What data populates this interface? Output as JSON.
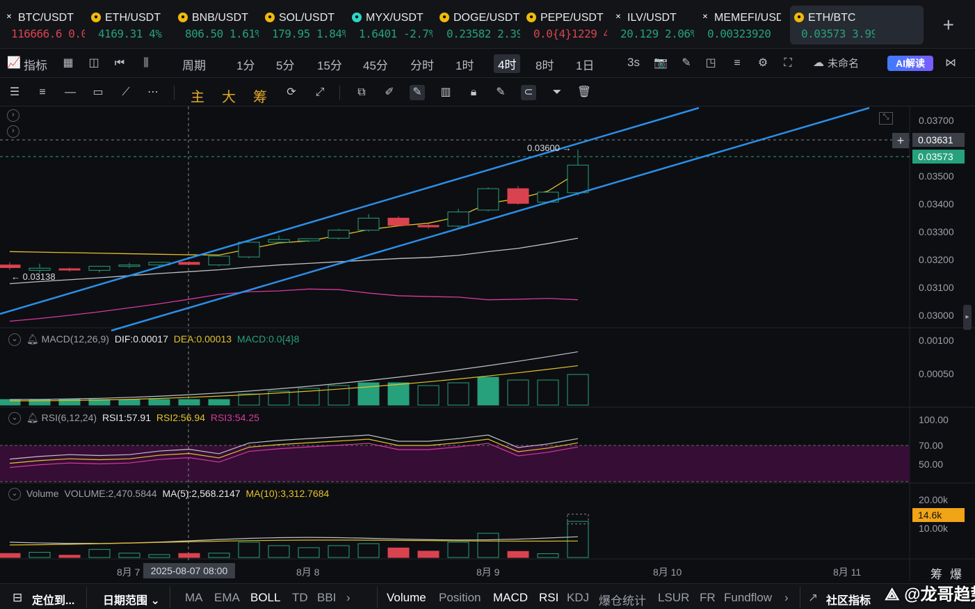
{
  "tickers": [
    {
      "name": "BTC/USDT",
      "price": "116666.6",
      "change": "0.0",
      "dir": "dn",
      "icon": "binance-icon",
      "color": "#ffffff"
    },
    {
      "name": "ETH/USDT",
      "price": "4169.31",
      "change": "4%",
      "dir": "up",
      "icon": "coin-icon",
      "color": "#f0b90b"
    },
    {
      "name": "BNB/USDT",
      "price": "806.50",
      "change": "1.61%",
      "dir": "up",
      "icon": "coin-icon",
      "color": "#f0b90b"
    },
    {
      "name": "SOL/USDT",
      "price": "179.95",
      "change": "1.84%",
      "dir": "up",
      "icon": "coin-icon",
      "color": "#f0b90b"
    },
    {
      "name": "MYX/USDT",
      "price": "1.6401",
      "change": "-2.7%",
      "dir": "up",
      "icon": "coin-icon",
      "color": "#2bd6c6"
    },
    {
      "name": "DOGE/USDT",
      "price": "0.23582",
      "change": "2.39%",
      "dir": "up",
      "icon": "coin-icon",
      "color": "#f0b90b"
    },
    {
      "name": "PEPE/USDT",
      "price": "0.0{4}1229",
      "change": "4",
      "dir": "dn",
      "icon": "coin-icon",
      "color": "#f0b90b"
    },
    {
      "name": "ILV/USDT",
      "price": "20.129",
      "change": "2.06%",
      "dir": "up",
      "icon": "binance-icon",
      "color": "#ffffff"
    },
    {
      "name": "MEMEFI/USDT",
      "price": "0.00323920",
      "change": "",
      "dir": "up",
      "icon": "binance-icon",
      "color": "#ffffff"
    },
    {
      "name": "ETH/BTC",
      "price": "0.03573",
      "change": "3.99%",
      "dir": "up",
      "icon": "coin-icon",
      "color": "#f0b90b"
    }
  ],
  "toolbar": {
    "indicators": "指标",
    "period": "周期",
    "intervals": [
      "1分",
      "5分",
      "15分",
      "45分",
      "分时",
      "1时",
      "4时",
      "8时",
      "1日",
      "3s"
    ],
    "selected_interval": "4时",
    "layout_name": "未命名",
    "ai_label": "AI解读"
  },
  "drawing_toolbar": {
    "chinese_tools": [
      "主",
      "大",
      "筹"
    ]
  },
  "price_axis": {
    "labels": [
      "0.03700",
      "0.03631",
      "0.03573",
      "0.03500",
      "0.03400",
      "0.03300",
      "0.03200",
      "0.03100",
      "0.03000"
    ],
    "crosshair_price": "0.03631",
    "last_price": "0.03573",
    "high_label": "0.03600",
    "low_label": "0.03138"
  },
  "macd": {
    "name": "MACD(12,26,9)",
    "dif": "DIF:0.00017",
    "dea": "DEA:0.00013",
    "macd": "MACD:0.0{4}8",
    "axis": [
      "0.00100",
      "0.00050"
    ]
  },
  "rsi": {
    "name": "RSI(6,12,24)",
    "rsi1": "RSI1:57.91",
    "rsi2": "RSI2:56.94",
    "rsi3": "RSI3:54.25",
    "axis": [
      "100.00",
      "70.00",
      "50.00"
    ]
  },
  "volume": {
    "name": "Volume",
    "vol": "VOLUME:2,470.5844",
    "ma5": "MA(5):2,568.2147",
    "ma10": "MA(10):3,312.7684",
    "axis": [
      "20.00k",
      "10.00k"
    ],
    "tag": "14.6k"
  },
  "xaxis": {
    "labels": [
      "8月 7",
      "8月 8",
      "8月 9",
      "8月 10",
      "8月 11"
    ],
    "crosshair_time": "2025-08-07 08:00",
    "right_labels": [
      "筹",
      "爆"
    ]
  },
  "bottom_bar": {
    "locate": "定位到...",
    "date_range": "日期范围",
    "main_indicators": [
      "MA",
      "EMA",
      "BOLL",
      "TD",
      "BBI"
    ],
    "sub_indicators": [
      "Volume",
      "Position",
      "MACD",
      "RSI",
      "KDJ",
      "爆仓统计",
      "LSUR",
      "FR",
      "Fundflow"
    ],
    "community": "社区指标",
    "watermark": "@龙哥趋势"
  },
  "chart_data": {
    "type": "candlestick",
    "interval": "4时",
    "x": [
      "8/6 20:00",
      "8/7 00:00",
      "8/7 04:00",
      "8/7 08:00",
      "8/7 12:00",
      "8/7 16:00",
      "8/7 20:00",
      "8/8 00:00",
      "8/8 04:00",
      "8/8 08:00",
      "8/8 12:00",
      "8/8 16:00",
      "8/8 20:00",
      "8/9 00:00",
      "8/9 04:00",
      "8/9 08:00",
      "8/9 12:00",
      "8/9 16:00",
      "8/9 20:00"
    ],
    "ohlc": [
      [
        0.032,
        0.0321,
        0.03182,
        0.0319
      ],
      [
        0.0318,
        0.03205,
        0.0317,
        0.03188
      ],
      [
        0.03186,
        0.0319,
        0.03175,
        0.03183
      ],
      [
        0.0318,
        0.03192,
        0.03172,
        0.03195
      ],
      [
        0.03195,
        0.03208,
        0.03188,
        0.032
      ],
      [
        0.032,
        0.03205,
        0.03188,
        0.0321
      ],
      [
        0.0321,
        0.03214,
        0.032,
        0.03202
      ],
      [
        0.032,
        0.03235,
        0.03195,
        0.03233
      ],
      [
        0.0323,
        0.0329,
        0.03225,
        0.03285
      ],
      [
        0.03285,
        0.0331,
        0.0328,
        0.03295
      ],
      [
        0.0329,
        0.033,
        0.03285,
        0.03298
      ],
      [
        0.033,
        0.03335,
        0.03295,
        0.0333
      ],
      [
        0.0333,
        0.0339,
        0.03325,
        0.03375
      ],
      [
        0.03375,
        0.03382,
        0.03345,
        0.03348
      ],
      [
        0.03348,
        0.03355,
        0.03335,
        0.03342
      ],
      [
        0.03345,
        0.0341,
        0.0334,
        0.03398
      ],
      [
        0.03405,
        0.0349,
        0.034,
        0.03485
      ],
      [
        0.03485,
        0.03495,
        0.03425,
        0.0343
      ],
      [
        0.03435,
        0.0348,
        0.0343,
        0.03472
      ],
      [
        0.0347,
        0.03631,
        0.0346,
        0.03573
      ]
    ],
    "ylim": [
      0.0296,
      0.0374
    ],
    "ma_yellow": [
      0.0325,
      0.03248,
      0.03246,
      0.03244,
      0.03242,
      0.0324,
      0.03238,
      0.03237,
      0.0326,
      0.03282,
      0.0329,
      0.0331,
      0.03332,
      0.03346,
      0.03356,
      0.0338,
      0.0343,
      0.03448,
      0.03476,
      0.03545
    ],
    "ma_white": [
      0.0313,
      0.03138,
      0.03145,
      0.03152,
      0.0316,
      0.03168,
      0.03175,
      0.03182,
      0.03192,
      0.032,
      0.03206,
      0.03212,
      0.03218,
      0.03224,
      0.03228,
      0.03236,
      0.0325,
      0.03262,
      0.0328,
      0.033
    ],
    "ma_pink": [
      0.0299,
      0.03,
      0.03012,
      0.03025,
      0.0304,
      0.03055,
      0.03072,
      0.0309,
      0.031,
      0.03103,
      0.0311,
      0.03108,
      0.03095,
      0.03085,
      0.03082,
      0.0308,
      0.0307,
      0.03072,
      0.03075,
      0.0307
    ],
    "macd_hist": [
      2e-05,
      2e-05,
      2e-05,
      2e-05,
      2e-05,
      2e-05,
      2e-05,
      2e-05,
      4e-05,
      5e-05,
      6e-05,
      7e-05,
      8e-05,
      8e-05,
      7e-05,
      8e-05,
      0.0001,
      9e-05,
      9e-05,
      0.00011
    ],
    "rsi1": [
      55,
      58,
      60,
      59,
      60,
      64,
      66,
      61,
      73,
      76,
      78,
      80,
      82,
      75,
      75,
      78,
      82,
      68,
      72,
      78
    ],
    "volume": [
      1400,
      1800,
      800,
      2800,
      1500,
      1000,
      1400,
      1500,
      5300,
      4100,
      3400,
      4100,
      4800,
      3300,
      2200,
      5300,
      8400,
      2100,
      1300,
      12500
    ]
  }
}
